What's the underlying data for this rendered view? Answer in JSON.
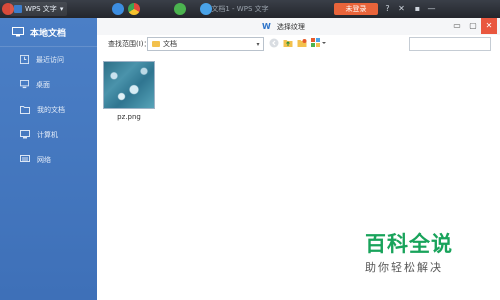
{
  "taskbar": {
    "app_label": "WPS 文字",
    "bg_window_title": "文档1 - WPS 文字",
    "orange_button": "未登录",
    "controls": [
      "?",
      "✕",
      "▪",
      "—"
    ]
  },
  "sidebar": {
    "title": "本地文档",
    "items": [
      {
        "label": "最近访问",
        "icon": "clock-icon"
      },
      {
        "label": "桌面",
        "icon": "desktop-icon"
      },
      {
        "label": "我的文档",
        "icon": "folder-icon"
      },
      {
        "label": "计算机",
        "icon": "computer-icon"
      },
      {
        "label": "网络",
        "icon": "network-icon"
      }
    ]
  },
  "dialog": {
    "title": "选择纹理",
    "look_in_label": "查找范围(I)：",
    "current_folder": "文档",
    "search_placeholder": ""
  },
  "files": [
    {
      "name": "pz.png"
    }
  ],
  "watermark": {
    "title": "百科全说",
    "subtitle": "助你轻松解决"
  },
  "colors": {
    "sidebar": "#4479c0",
    "close_button": "#e9573f",
    "watermark": "#19a35b"
  }
}
